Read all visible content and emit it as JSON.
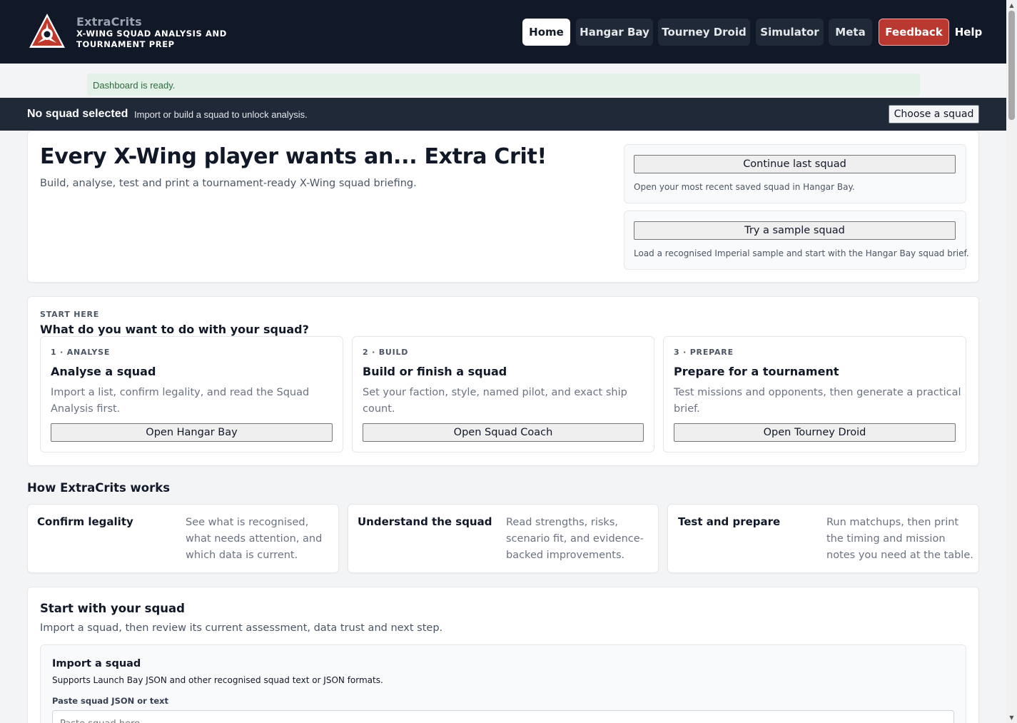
{
  "header": {
    "brand_name": "ExtraCrits",
    "brand_tagline": "X-WING SQUAD ANALYSIS AND TOURNAMENT PREP",
    "nav": {
      "home": "Home",
      "hangar_bay": "Hangar Bay",
      "tourney_droid": "Tourney Droid",
      "simulator": "Simulator",
      "meta": "Meta",
      "feedback": "Feedback",
      "help": "Help"
    }
  },
  "alert": {
    "message": "Dashboard is ready."
  },
  "squad_bar": {
    "status": "No squad selected",
    "hint": "Import or build a squad to unlock analysis.",
    "choose_button": "Choose a squad"
  },
  "hero": {
    "title": "Every X-Wing player wants an... Extra Crit!",
    "subtitle": "Build, analyse, test and print a tournament-ready X-Wing squad briefing.",
    "continue_button": "Continue last squad",
    "continue_note": "Open your most recent saved squad in Hangar Bay.",
    "sample_button": "Try a sample squad",
    "sample_note": "Load a recognised Imperial sample and start with the Hangar Bay squad brief."
  },
  "start_here": {
    "eyebrow": "START HERE",
    "heading": "What do you want to do with your squad?",
    "steps": [
      {
        "eyebrow": "1 · ANALYSE",
        "title": "Analyse a squad",
        "body_line1": "Import a list, confirm legality, and read the Squad",
        "body_line2": "Analysis first.",
        "button": "Open Hangar Bay"
      },
      {
        "eyebrow": "2 · BUILD",
        "title": "Build or finish a squad",
        "body_line1": "Set your faction, style, named pilot, and exact ship",
        "body_line2": "count.",
        "button": "Open Squad Coach"
      },
      {
        "eyebrow": "3 · PREPARE",
        "title": "Prepare for a tournament",
        "body_line1": "Test missions and opponents, then generate a practical",
        "body_line2": "brief.",
        "button": "Open Tourney Droid"
      }
    ]
  },
  "how": {
    "heading": "How ExtraCrits works",
    "items": [
      {
        "title": "Confirm legality",
        "body_line1": "See what is recognised,",
        "body_line2": "what needs attention, and",
        "body_line3": "which data is current."
      },
      {
        "title": "Understand the squad",
        "body_line1": "Read strengths, risks,",
        "body_line2": "scenario fit, and evidence-",
        "body_line3": "backed improvements."
      },
      {
        "title": "Test and prepare",
        "body_line1": "Run matchups, then print",
        "body_line2": "the timing and mission",
        "body_line3": "notes you need at the table."
      }
    ]
  },
  "start_with": {
    "heading": "Start with your squad",
    "subtitle": "Import a squad, then review its current assessment, data trust and next step.",
    "import_title": "Import a squad",
    "import_subtitle": "Supports Launch Bay JSON and other recognised squad text or JSON formats.",
    "field_label": "Paste squad JSON or text",
    "field_placeholder": "Paste squad here..."
  },
  "colors": {
    "header_bg": "#111827",
    "feedback_red": "#b9382f",
    "alert_bg": "#e3f1e8",
    "logo_red": "#c0392b"
  },
  "icons": {
    "logo": "extracrits-logo-icon",
    "scroll_up": "scroll-up-arrow-icon",
    "scroll_down": "scroll-down-arrow-icon"
  }
}
